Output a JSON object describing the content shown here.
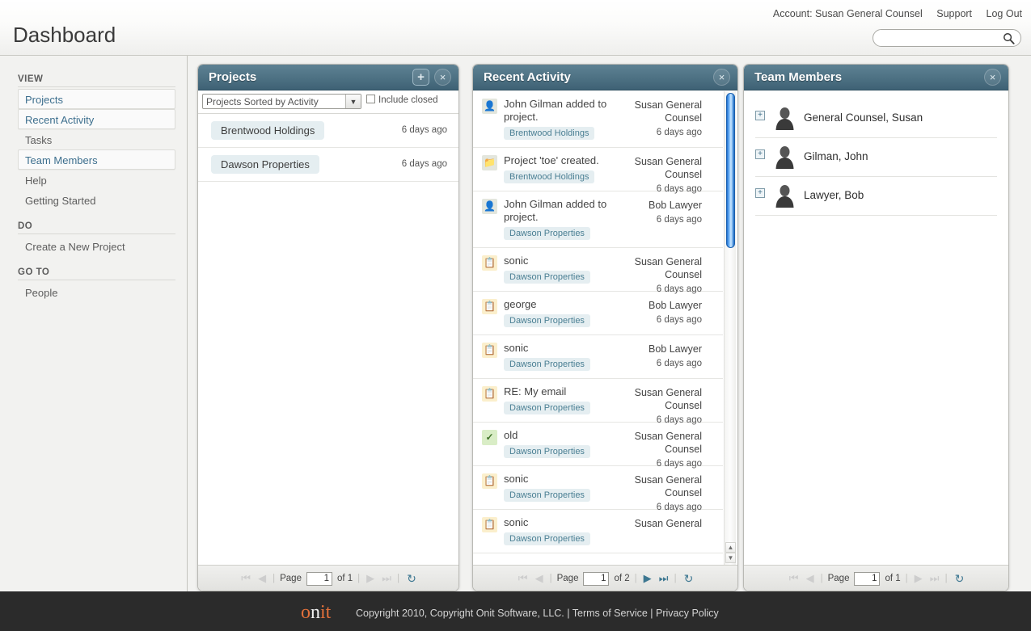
{
  "header": {
    "title": "Dashboard",
    "account_label": "Account: Susan General Counsel",
    "support_label": "Support",
    "logout_label": "Log Out",
    "search_value": "",
    "search_placeholder": ""
  },
  "sidebar": {
    "groups": [
      {
        "title": "VIEW",
        "items": [
          {
            "label": "Projects",
            "style": "boxed-link"
          },
          {
            "label": "Recent Activity",
            "style": "boxed-link"
          },
          {
            "label": "Tasks",
            "style": "plain"
          },
          {
            "label": "Team Members",
            "style": "boxed-link"
          },
          {
            "label": "Help",
            "style": "plain"
          },
          {
            "label": "Getting Started",
            "style": "plain"
          }
        ]
      },
      {
        "title": "DO",
        "items": [
          {
            "label": "Create a New Project",
            "style": "plain"
          }
        ]
      },
      {
        "title": "GO TO",
        "items": [
          {
            "label": "People",
            "style": "plain"
          }
        ]
      }
    ]
  },
  "projects_panel": {
    "title": "Projects",
    "add_label": "+",
    "close_label": "×",
    "sort_selected": "Projects Sorted by Activity",
    "include_closed_label": "Include closed",
    "include_closed_checked": false,
    "rows": [
      {
        "name": "Brentwood Holdings",
        "when": "6 days ago"
      },
      {
        "name": "Dawson Properties",
        "when": "6 days ago"
      }
    ],
    "pager": {
      "page_word": "Page",
      "value": "1",
      "of": "of 1"
    }
  },
  "activity_panel": {
    "title": "Recent Activity",
    "close_label": "×",
    "rows": [
      {
        "icon": "person-icon",
        "icon_class": "ic-person",
        "text": "John Gilman added to project.",
        "tag": "Brentwood Holdings",
        "who": "Susan General Counsel",
        "when": "6 days ago"
      },
      {
        "icon": "folder-icon",
        "icon_class": "ic-folder",
        "text": "Project 'toe' created.",
        "tag": "Brentwood Holdings",
        "who": "Susan General Counsel",
        "when": "6 days ago"
      },
      {
        "icon": "person-icon",
        "icon_class": "ic-person",
        "text": "John Gilman added to project.",
        "tag": "Dawson Properties",
        "who": "Bob Lawyer",
        "when": "6 days ago"
      },
      {
        "icon": "note-icon",
        "icon_class": "ic-note",
        "text": "sonic",
        "tag": "Dawson Properties",
        "who": "Susan General Counsel",
        "when": "6 days ago"
      },
      {
        "icon": "note-icon",
        "icon_class": "ic-note",
        "text": "george",
        "tag": "Dawson Properties",
        "who": "Bob Lawyer",
        "when": "6 days ago"
      },
      {
        "icon": "note-icon",
        "icon_class": "ic-note",
        "text": "sonic",
        "tag": "Dawson Properties",
        "who": "Bob Lawyer",
        "when": "6 days ago"
      },
      {
        "icon": "note-icon",
        "icon_class": "ic-note",
        "text": "RE: My email",
        "tag": "Dawson Properties",
        "who": "Susan General Counsel",
        "when": "6 days ago"
      },
      {
        "icon": "check-icon",
        "icon_class": "ic-check",
        "text": "old",
        "tag": "Dawson Properties",
        "who": "Susan General Counsel",
        "when": "6 days ago"
      },
      {
        "icon": "note-icon",
        "icon_class": "ic-note",
        "text": "sonic",
        "tag": "Dawson Properties",
        "who": "Susan General Counsel",
        "when": "6 days ago"
      },
      {
        "icon": "note-icon",
        "icon_class": "ic-note",
        "text": "sonic",
        "tag": "Dawson Properties",
        "who": "Susan General",
        "when": ""
      }
    ],
    "pager": {
      "page_word": "Page",
      "value": "1",
      "of": "of 2"
    }
  },
  "team_panel": {
    "title": "Team Members",
    "close_label": "×",
    "rows": [
      {
        "expand": "+",
        "name": "General Counsel, Susan"
      },
      {
        "expand": "+",
        "name": "Gilman, John"
      },
      {
        "expand": "+",
        "name": "Lawyer, Bob"
      }
    ],
    "pager": {
      "page_word": "Page",
      "value": "1",
      "of": "of 1"
    }
  },
  "footer": {
    "brand_o": "o",
    "brand_n": "n",
    "brand_it": "it",
    "copyright": "Copyright 2010, Copyright Onit Software, LLC. | Terms of Service | Privacy Policy"
  },
  "colors": {
    "panel_header": "#4d7183",
    "accent_link": "#3d6f8e",
    "tag_bg": "#e5eef1",
    "brand_orange": "#e2703a",
    "footer_bg": "#2b2b2b",
    "page_bg": "#f2f2f0"
  }
}
